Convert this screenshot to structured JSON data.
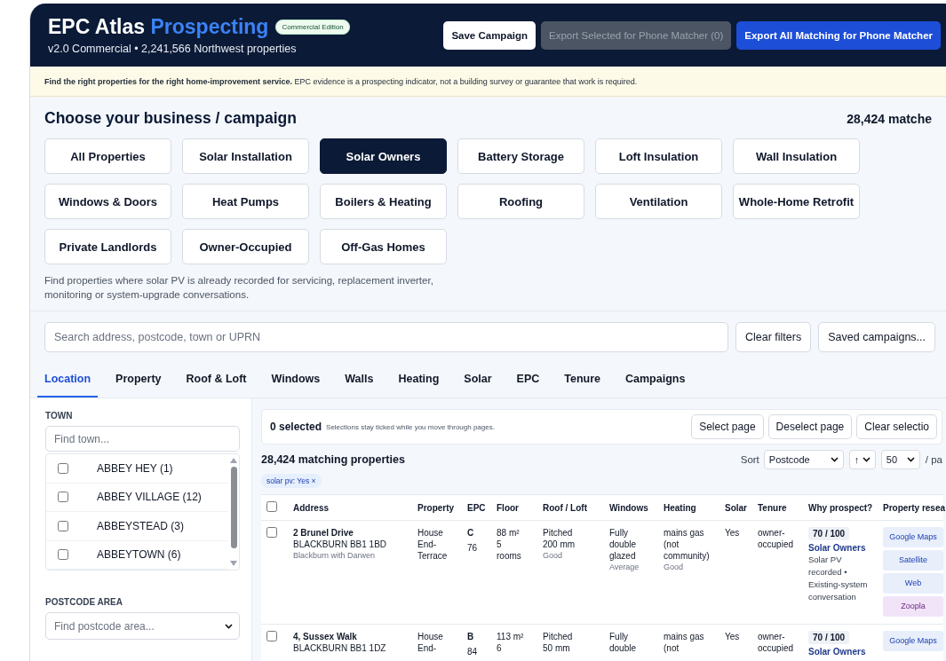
{
  "header": {
    "brand": "EPC Atlas",
    "brand_accent": "Prospecting",
    "edition_badge": "Commercial Edition",
    "subtitle": "v2.0 Commercial • 2,241,566 Northwest properties",
    "buttons": [
      {
        "label": "Save Campaign",
        "kind": "light",
        "disabled": false
      },
      {
        "label": "Export Selected for Phone Matcher (0)",
        "kind": "primary",
        "disabled": true
      },
      {
        "label": "Export All Matching for Phone Matcher",
        "kind": "primary",
        "disabled": false
      }
    ]
  },
  "notice": "**Find the right properties for the right home-improvement service.** EPC evidence is a prospecting indicator, not a building survey or guarantee that work is required.",
  "campaign_section": {
    "title": "Choose your business / campaign",
    "match_count": "28,424 matche",
    "campaigns": [
      {
        "label": "All Properties",
        "selected": false
      },
      {
        "label": "Solar Installation",
        "selected": false
      },
      {
        "label": "Solar Owners",
        "selected": true
      },
      {
        "label": "Battery Storage",
        "selected": false
      },
      {
        "label": "Loft Insulation",
        "selected": false
      },
      {
        "label": "Wall Insulation",
        "selected": false
      },
      {
        "label": "Windows & Doors",
        "selected": false
      },
      {
        "label": "Heat Pumps",
        "selected": false
      },
      {
        "label": "Boilers & Heating",
        "selected": false
      },
      {
        "label": "Roofing",
        "selected": false
      },
      {
        "label": "Ventilation",
        "selected": false
      },
      {
        "label": "Whole-Home Retrofit",
        "selected": false
      },
      {
        "label": "Private Landlords",
        "selected": false
      },
      {
        "label": "Owner-Occupied",
        "selected": false
      },
      {
        "label": "Off-Gas Homes",
        "selected": false
      }
    ],
    "description": "Find properties where solar PV is already recorded for servicing, replacement inverter, monitoring or system-upgrade conversations."
  },
  "search": {
    "placeholder": "Search address, postcode, town or UPRN",
    "buttons": [
      "Clear filters",
      "Saved campaigns..."
    ]
  },
  "filter_tabs": [
    {
      "label": "Location",
      "selected": true
    },
    {
      "label": "Property",
      "selected": false
    },
    {
      "label": "Roof & Loft",
      "selected": false
    },
    {
      "label": "Windows",
      "selected": false
    },
    {
      "label": "Walls",
      "selected": false
    },
    {
      "label": "Heating",
      "selected": false
    },
    {
      "label": "Solar",
      "selected": false
    },
    {
      "label": "EPC",
      "selected": false
    },
    {
      "label": "Tenure",
      "selected": false
    },
    {
      "label": "Campaigns",
      "selected": false
    }
  ],
  "sidebar": {
    "town_label": "TOWN",
    "town_placeholder": "Find town...",
    "towns": [
      {
        "label": "ABBEY HEY (1)",
        "checked": false
      },
      {
        "label": "ABBEY VILLAGE (12)",
        "checked": false
      },
      {
        "label": "ABBEYSTEAD (3)",
        "checked": false
      },
      {
        "label": "ABBEYTOWN (6)",
        "checked": false
      }
    ],
    "postcode_label": "POSTCODE AREA",
    "postcode_placeholder": "Find postcode area..."
  },
  "selection_bar": {
    "count": "0 selected",
    "hint": "Selections stay ticked while you move through pages.",
    "buttons": [
      "Select page",
      "Deselect page",
      "Clear selectio"
    ]
  },
  "results": {
    "title": "28,424 matching properties",
    "sort_label": "Sort",
    "sort_value": "Postcode",
    "direction": "↑",
    "page_size": "50",
    "page_suffix": "/ pa",
    "chips": [
      {
        "label": "solar pv: Yes",
        "remove": "×"
      }
    ],
    "all_checked": false,
    "columns": [
      "Address",
      "Property",
      "EPC",
      "Floor",
      "Roof / Loft",
      "Windows",
      "Heating",
      "Solar",
      "Tenure",
      "Why prospect?",
      "Property resea"
    ],
    "rows": [
      {
        "checked": false,
        "address": [
          "2 Brunel Drive",
          "BLACKBURN BB1 1BD",
          "Blackburn with Darwen"
        ],
        "property": [
          "House",
          "End-",
          "Terrace"
        ],
        "epc": {
          "band": "C",
          "score": "76"
        },
        "floor": [
          "88 m²",
          "5",
          "rooms"
        ],
        "roof": {
          "lines": [
            "Pitched",
            "200 mm"
          ],
          "rating": "Good"
        },
        "windows": {
          "lines": [
            "Fully",
            "double",
            "glazed"
          ],
          "rating": "Average"
        },
        "heating": {
          "lines": [
            "mains gas",
            "(not",
            "community)"
          ],
          "rating": "Good"
        },
        "solar": "Yes",
        "tenure": [
          "owner-",
          "occupied"
        ],
        "why": {
          "score": "70 / 100",
          "campaign": "Solar Owners",
          "notes": [
            "Solar PV",
            "recorded •",
            "Existing-system",
            "conversation"
          ]
        },
        "research": [
          {
            "label": "Google Maps",
            "kind": "map"
          },
          {
            "label": "Satellite",
            "kind": "map"
          },
          {
            "label": "Web",
            "kind": "map"
          },
          {
            "label": "Zoopla",
            "kind": "listing"
          }
        ]
      },
      {
        "checked": false,
        "address": [
          "4, Sussex Walk",
          "BLACKBURN BB1 1DZ"
        ],
        "property": [
          "House",
          "End-"
        ],
        "epc": {
          "band": "B",
          "score": "84"
        },
        "floor": [
          "113 m²",
          "6"
        ],
        "roof": {
          "lines": [
            "Pitched",
            "50 mm"
          ]
        },
        "windows": {
          "lines": [
            "Fully",
            "double"
          ]
        },
        "heating": {
          "lines": [
            "mains gas",
            "(not"
          ]
        },
        "solar": "Yes",
        "tenure": [
          "owner-",
          "occupied"
        ],
        "why": {
          "score": "70 / 100",
          "campaign": "Solar Owners"
        },
        "research": [
          {
            "label": "Google Maps",
            "kind": "map"
          }
        ]
      }
    ]
  }
}
